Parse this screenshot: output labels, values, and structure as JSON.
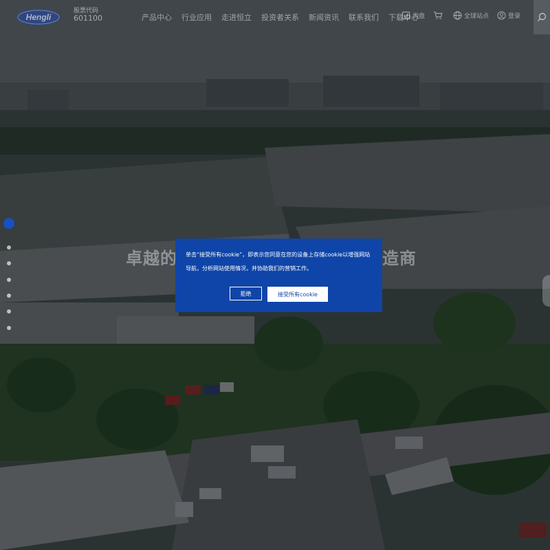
{
  "header": {
    "logo_text": "Hengli",
    "stock_label": "股票代码",
    "stock_code": "601100",
    "nav": [
      "产品中心",
      "行业应用",
      "走进恒立",
      "投资者关系",
      "新闻资讯",
      "联系我们",
      "下载中心"
    ],
    "tools": {
      "inquiry_label": "询盘",
      "language_label": "全球站点",
      "login_label": "登录"
    }
  },
  "hero": {
    "headline_left": "卓越的",
    "headline_right": "制造商"
  },
  "slider": {
    "count": 7,
    "active_index": 0
  },
  "cookie_banner": {
    "text": "单击“接受所有cookie”，即表示您同意在您的设备上存储cookie以增强网站导航，分析网站使用情况，并协助我们的营销工作。",
    "reject_label": "拒绝",
    "accept_label": "接受所有cookie"
  },
  "colors": {
    "brand_blue": "#0f45a8",
    "dot_active": "#1a4fc0"
  }
}
